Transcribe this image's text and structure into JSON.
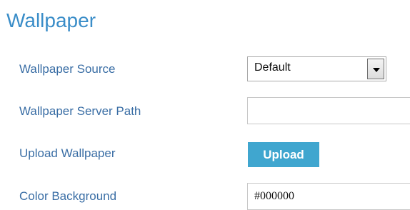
{
  "section": {
    "title": "Wallpaper"
  },
  "fields": {
    "wallpaper_source": {
      "label": "Wallpaper Source",
      "selected": "Default"
    },
    "wallpaper_server_path": {
      "label": "Wallpaper Server Path",
      "value": ""
    },
    "upload_wallpaper": {
      "label": "Upload Wallpaper",
      "button_label": "Upload"
    },
    "color_background": {
      "label": "Color Background",
      "value": "#000000"
    }
  },
  "colors": {
    "title": "#3a8dc8",
    "label": "#3a6ea5",
    "button": "#40a6cf"
  }
}
